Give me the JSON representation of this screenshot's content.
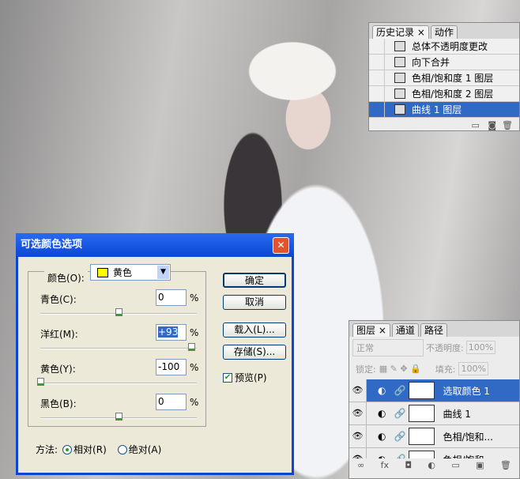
{
  "history": {
    "tabs": [
      "历史记录",
      "动作"
    ],
    "items": [
      "总体不透明度更改",
      "向下合并",
      "色相/饱和度 1 图层",
      "色相/饱和度 2 图层",
      "曲线 1 图层"
    ],
    "selected": 4
  },
  "dialog": {
    "title": "可选颜色选项",
    "color_label": "颜色(O):",
    "color_value": "黄色",
    "swatch": "#ffff00",
    "sliders": [
      {
        "label": "青色(C):",
        "value": "0",
        "pct": 0
      },
      {
        "label": "洋红(M):",
        "value": "+93",
        "pct": 93
      },
      {
        "label": "黄色(Y):",
        "value": "-100",
        "pct": -100
      },
      {
        "label": "黑色(B):",
        "value": "0",
        "pct": 0
      }
    ],
    "percent": "%",
    "ok": "确定",
    "cancel": "取消",
    "load": "载入(L)...",
    "save": "存储(S)...",
    "preview": "预览(P)",
    "method_label": "方法:",
    "relative": "相对(R)",
    "absolute": "绝对(A)"
  },
  "layers": {
    "tabs": [
      "图层",
      "通道",
      "路径"
    ],
    "blend": "正常",
    "opacity_label": "不透明度:",
    "opacity": "100%",
    "lock_label": "锁定:",
    "fill_label": "填充:",
    "fill": "100%",
    "items": [
      "选取颜色 1",
      "曲线 1",
      "色相/饱和...",
      "色相/饱和..."
    ]
  }
}
